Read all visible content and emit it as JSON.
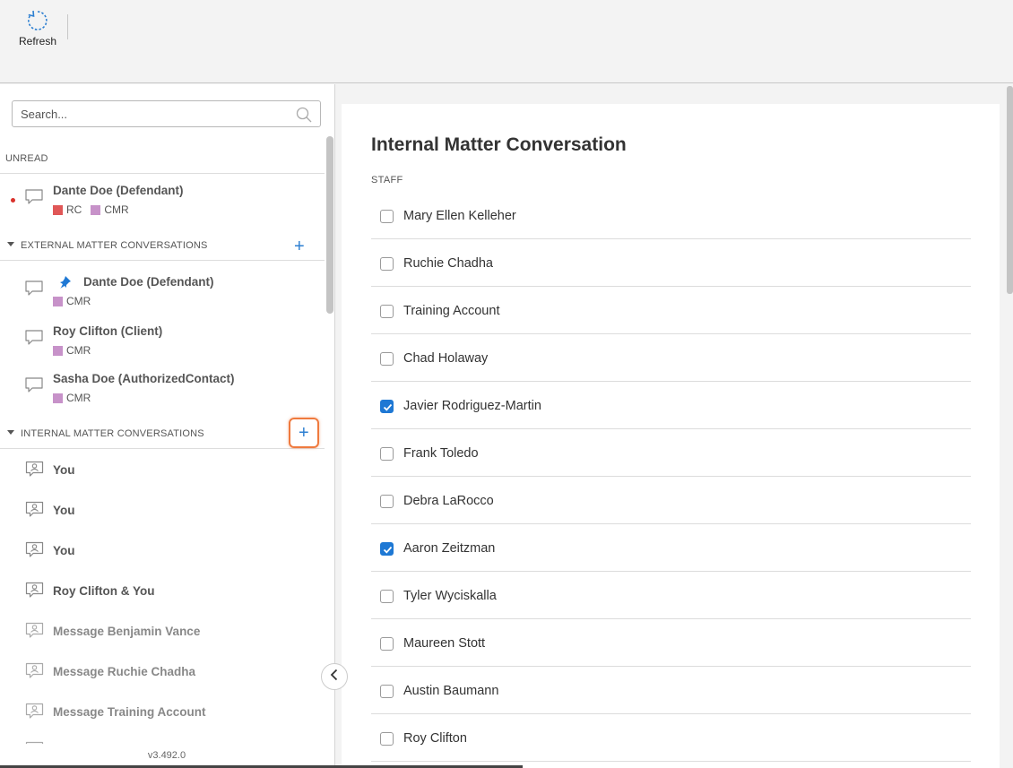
{
  "toolbar": {
    "refresh_label": "Refresh",
    "refresh_icon": "refresh-icon"
  },
  "search": {
    "placeholder": "Search...",
    "value": ""
  },
  "unread": {
    "label": "UNREAD",
    "items": [
      {
        "name": "Dante Doe (Defendant)",
        "tags": [
          {
            "label": "RC",
            "color": "#e05757"
          },
          {
            "label": "CMR",
            "color": "#c792c9"
          }
        ]
      }
    ]
  },
  "external": {
    "label": "EXTERNAL MATTER CONVERSATIONS",
    "add_label": "+",
    "items": [
      {
        "name": "Dante Doe (Defendant)",
        "pinned": true,
        "tag": "CMR"
      },
      {
        "name": "Roy Clifton (Client)",
        "pinned": false,
        "tag": "CMR"
      },
      {
        "name": "Sasha Doe (AuthorizedContact)",
        "pinned": false,
        "tag": "CMR"
      }
    ]
  },
  "internal": {
    "label": "INTERNAL MATTER CONVERSATIONS",
    "add_label": "+",
    "items": [
      {
        "name": "You"
      },
      {
        "name": "You"
      },
      {
        "name": "You"
      },
      {
        "name": "Roy Clifton & You"
      },
      {
        "name": "Message Benjamin Vance"
      },
      {
        "name": "Message Ruchie Chadha"
      },
      {
        "name": "Message Training Account"
      }
    ]
  },
  "version": "v3.492.0",
  "colors": {
    "accent": "#1e78d4",
    "focus_ring": "#ef7a3e",
    "unread_dot": "#d9312b"
  },
  "main": {
    "title": "Internal Matter Conversation",
    "staff_label": "STAFF",
    "staff": [
      {
        "name": "Mary Ellen Kelleher",
        "checked": false
      },
      {
        "name": "Ruchie Chadha",
        "checked": false
      },
      {
        "name": "Training Account",
        "checked": false
      },
      {
        "name": "Chad Holaway",
        "checked": false
      },
      {
        "name": "Javier Rodriguez-Martin",
        "checked": true
      },
      {
        "name": "Frank Toledo",
        "checked": false
      },
      {
        "name": "Debra LaRocco",
        "checked": false
      },
      {
        "name": "Aaron Zeitzman",
        "checked": true
      },
      {
        "name": "Tyler Wyciskalla",
        "checked": false
      },
      {
        "name": "Maureen Stott",
        "checked": false
      },
      {
        "name": "Austin Baumann",
        "checked": false
      },
      {
        "name": "Roy Clifton",
        "checked": false
      }
    ]
  }
}
